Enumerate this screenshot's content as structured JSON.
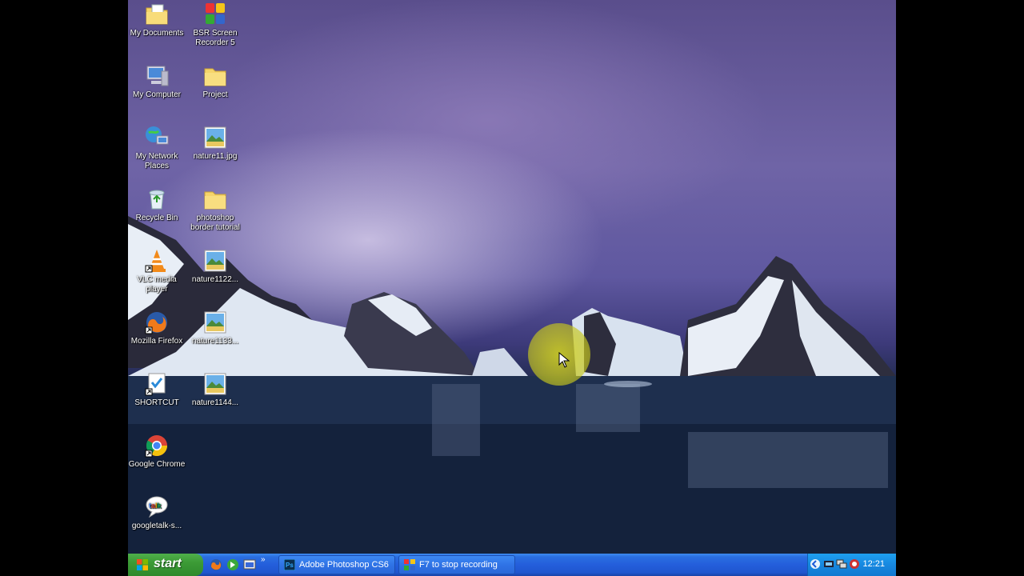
{
  "desktop_icons": [
    {
      "name": "my-documents",
      "label": "My Documents",
      "icon": "documents-folder-icon"
    },
    {
      "name": "bsr-screen-recorder",
      "label": "BSR Screen Recorder 5",
      "icon": "bsr-recorder-icon"
    },
    {
      "name": "my-computer",
      "label": "My Computer",
      "icon": "computer-icon"
    },
    {
      "name": "project",
      "label": "Project",
      "icon": "folder-icon"
    },
    {
      "name": "my-network-places",
      "label": "My Network Places",
      "icon": "network-icon"
    },
    {
      "name": "nature11",
      "label": "nature11.jpg",
      "icon": "image-file-icon"
    },
    {
      "name": "recycle-bin",
      "label": "Recycle Bin",
      "icon": "recycle-bin-icon"
    },
    {
      "name": "photoshop-border-tutorial",
      "label": "photoshop border tutorial",
      "icon": "folder-icon"
    },
    {
      "name": "vlc-media-player",
      "label": "VLC media player",
      "icon": "vlc-icon"
    },
    {
      "name": "nature1122",
      "label": "nature1122...",
      "icon": "image-file-icon"
    },
    {
      "name": "mozilla-firefox",
      "label": "Mozilla Firefox",
      "icon": "firefox-icon"
    },
    {
      "name": "nature1133",
      "label": "nature1133...",
      "icon": "image-file-icon"
    },
    {
      "name": "shortcut",
      "label": "SHORTCUT",
      "icon": "shortcut-icon"
    },
    {
      "name": "nature1144",
      "label": "nature1144...",
      "icon": "image-file-icon"
    },
    {
      "name": "google-chrome",
      "label": "Google Chrome",
      "icon": "chrome-icon"
    },
    {
      "name": "googletalk",
      "label": "googletalk-s...",
      "icon": "googletalk-icon"
    }
  ],
  "taskbar": {
    "start_label": "start",
    "tasks": [
      {
        "label": "Adobe Photoshop CS6",
        "icon": "photoshop-icon"
      },
      {
        "label": "F7 to stop recording",
        "icon": "bsr-recorder-icon"
      }
    ],
    "clock": "12:21"
  },
  "colors": {
    "taskbar_blue": "#245edb",
    "start_green": "#3c9a36",
    "tray_blue": "#1788e0",
    "cursor_highlight": "#d7d71e"
  }
}
